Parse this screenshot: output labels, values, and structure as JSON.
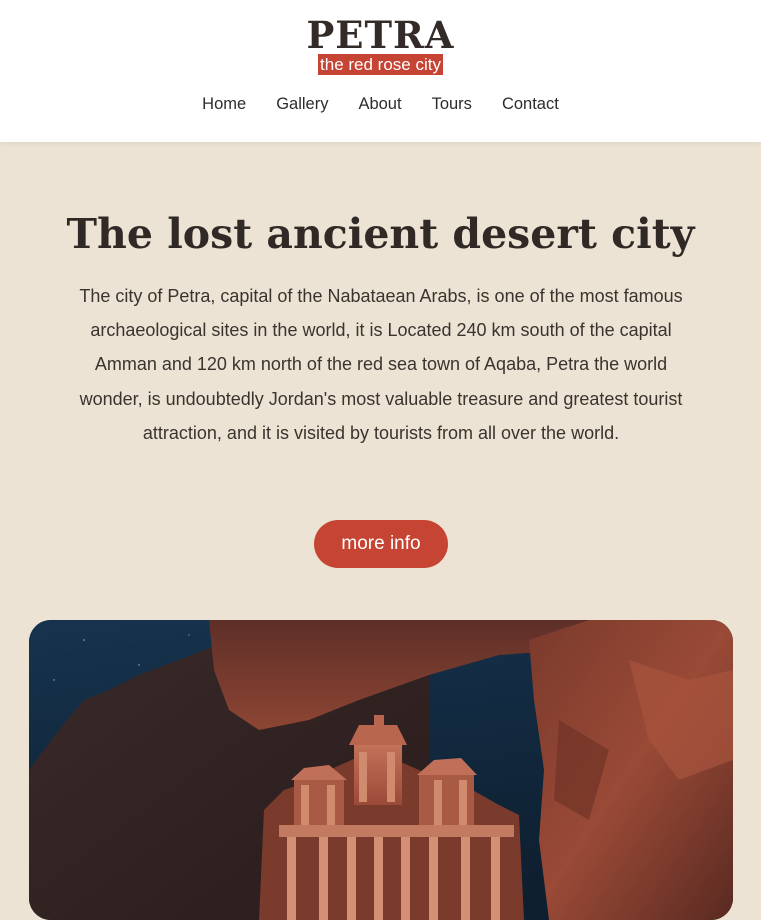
{
  "header": {
    "logo_title": "PETRA",
    "logo_tagline": "the red rose city"
  },
  "nav": {
    "items": [
      "Home",
      "Gallery",
      "About",
      "Tours",
      "Contact"
    ]
  },
  "hero": {
    "title": "The lost ancient desert city",
    "paragraph": "The city of Petra, capital of the Nabataean Arabs, is one of the most famous archaeological sites in the world, it is Located 240 km south of the capital Amman and 120 km north of the red sea town of Aqaba, Petra the world wonder, is undoubtedly Jordan's most valuable treasure and greatest tourist attraction, and it is visited by tourists from all over the world.",
    "cta_label": "more info"
  },
  "colors": {
    "accent": "#c64433",
    "background": "#ece3d4",
    "header_bg": "#ffffff",
    "text": "#312925"
  },
  "image": {
    "subject": "petra-treasury-photo"
  }
}
